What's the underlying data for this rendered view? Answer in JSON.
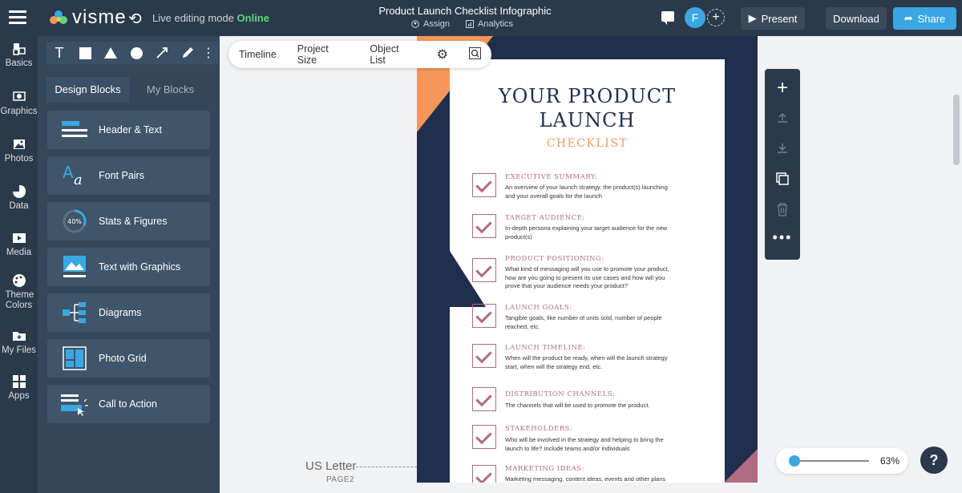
{
  "app": {
    "logo": "visme",
    "live_prefix": "Live editing mode",
    "live_status": "Online",
    "document_title": "Product Launch Checklist Infographic",
    "assign": "Assign",
    "analytics": "Analytics",
    "avatar_initial": "F",
    "present": "Present",
    "download": "Download",
    "share": "Share",
    "share_color": "#3aa7e3"
  },
  "rail": [
    {
      "label": "Basics"
    },
    {
      "label": "Graphics"
    },
    {
      "label": "Photos"
    },
    {
      "label": "Data"
    },
    {
      "label": "Media"
    },
    {
      "label": "Theme Colors"
    },
    {
      "label": "My Files"
    },
    {
      "label": "Apps"
    }
  ],
  "panel": {
    "tabs": [
      "Design Blocks",
      "My Blocks"
    ],
    "blocks": [
      {
        "label": "Header & Text",
        "icon": "header-text-icon"
      },
      {
        "label": "Font Pairs",
        "icon": "font-pairs-icon"
      },
      {
        "label": "Stats & Figures",
        "icon": "stats-icon",
        "badge": "40%"
      },
      {
        "label": "Text with Graphics",
        "icon": "text-graphics-icon"
      },
      {
        "label": "Diagrams",
        "icon": "diagram-icon"
      },
      {
        "label": "Photo Grid",
        "icon": "photo-grid-icon"
      },
      {
        "label": "Call to Action",
        "icon": "cta-icon"
      }
    ]
  },
  "toolbar": {
    "timeline": "Timeline",
    "project_size": "Project Size",
    "object_list": "Object List"
  },
  "page_info": {
    "size": "US Letter",
    "page": "PAGE2"
  },
  "document": {
    "title_line1": "YOUR PRODUCT",
    "title_line2": "LAUNCH",
    "subtitle": "CHECKLIST",
    "items": [
      {
        "title": "EXECUTIVE SUMMARY:",
        "desc": "An overview of your launch strategy, the product(s) launching and your overall goals for the launch"
      },
      {
        "title": "TARGET AUDIENCE:",
        "desc": "In-depth persona explaining your target audience for the new product(s)"
      },
      {
        "title": "PRODUCT POSITIONING:",
        "desc": "What kind of messaging will you use to promote your product, how are you going to present its use cases and how will you prove that your audience needs your product?"
      },
      {
        "title": "LAUNCH GOALS:",
        "desc": "Tangible goals, like number of units sold, number of people reached, etc."
      },
      {
        "title": "LAUNCH TIMELINE:",
        "desc": "When will the product be ready, when will the launch strategy start, when will the strategy end, etc."
      },
      {
        "title": "DISTRIBUTION CHANNELS:",
        "desc": "The channels that will be used to promote the product."
      },
      {
        "title": "STAKEHOLDERS:",
        "desc": "Who will be involved in the strategy and helping to bring the launch to life? Include teams and/or individuals"
      },
      {
        "title": "MARKETING IDEAS:",
        "desc": "Marketing messaging, content ideas, events and other plans"
      }
    ]
  },
  "zoom": {
    "value": "63%"
  },
  "help": "?"
}
